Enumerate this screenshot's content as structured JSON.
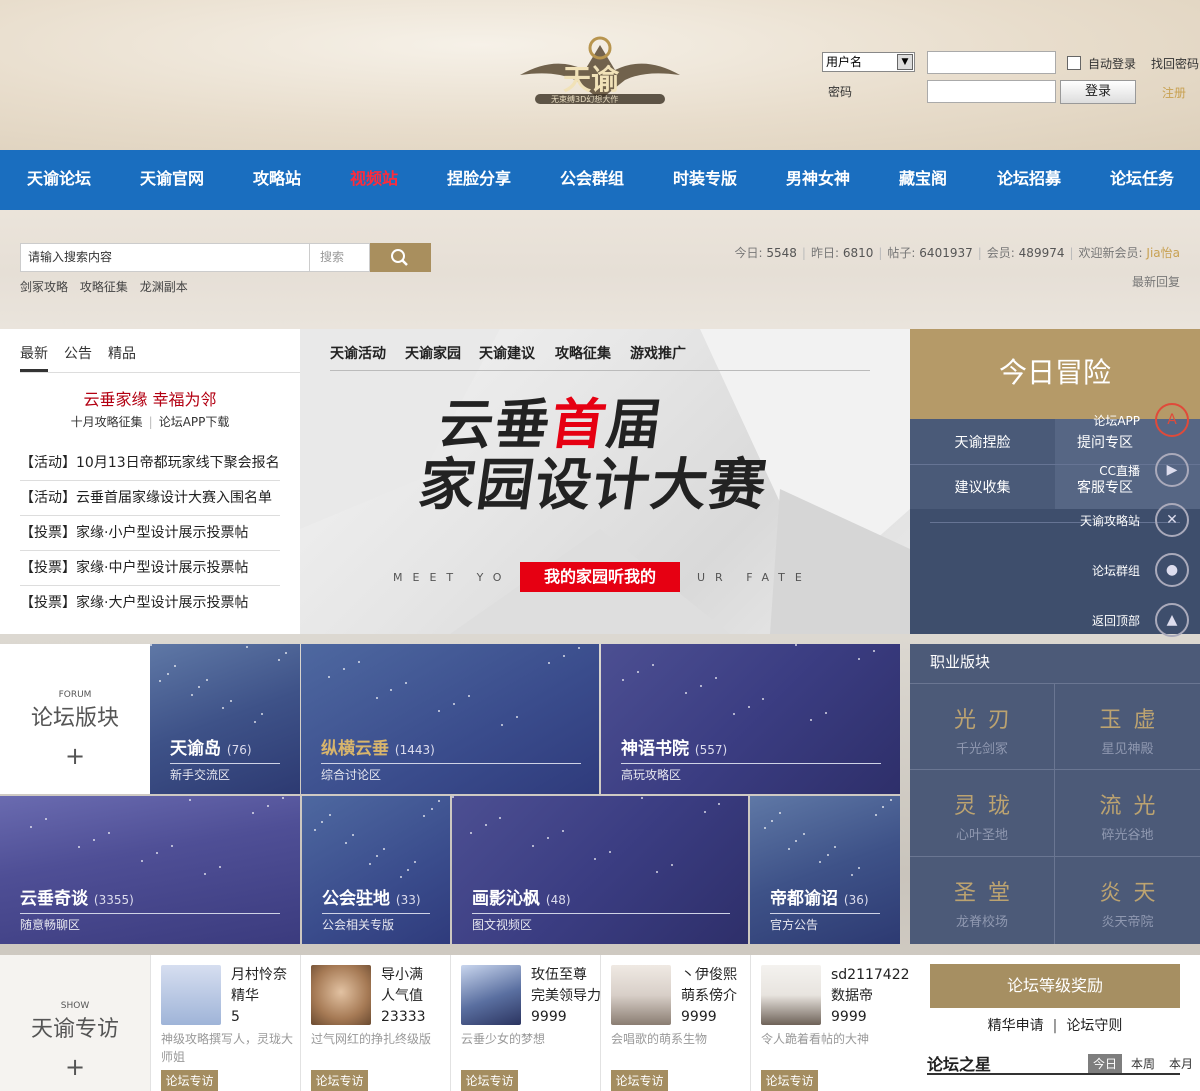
{
  "header": {
    "logo_text": "天谕",
    "logo_sub": "无束缚3D幻想大作",
    "login": {
      "user_select": "用户名",
      "password_label": "密码",
      "auto_login": "自动登录",
      "find_password": "找回密码",
      "login_button": "登录",
      "register": "注册"
    }
  },
  "nav": {
    "items": [
      "天谕论坛",
      "天谕官网",
      "攻略站",
      "视频站",
      "捏脸分享",
      "公会群组",
      "时装专版",
      "男神女神",
      "藏宝阁",
      "论坛招募",
      "论坛任务"
    ],
    "highlight_index": 3
  },
  "search": {
    "placeholder": "请输入搜索内容",
    "type": "搜索",
    "tags": [
      "剑冢攻略",
      "攻略征集",
      "龙渊副本"
    ]
  },
  "stats": {
    "today_label": "今日:",
    "today": "5548",
    "yesterday_label": "昨日:",
    "yesterday": "6810",
    "posts_label": "帖子:",
    "posts": "6401937",
    "members_label": "会员:",
    "members": "489974",
    "welcome_label": "欢迎新会员:",
    "new_member": "Jia怡a",
    "latest_reply": "最新回复"
  },
  "news": {
    "tabs": [
      "最新",
      "公告",
      "精品"
    ],
    "headline": "云垂家缘  幸福为邻",
    "sub_left": "十月攻略征集",
    "sub_right": "论坛APP下载",
    "items": [
      "【活动】10月13日帝都玩家线下聚会报名",
      "【活动】云垂首届家缘设计大赛入围名单",
      "【投票】家缘·小户型设计展示投票帖",
      "【投票】家缘·中户型设计展示投票帖",
      "【投票】家缘·大户型设计展示投票帖"
    ]
  },
  "banner": {
    "tabs": [
      "天谕活动",
      "天谕家园",
      "天谕建议",
      "攻略征集",
      "游戏推广"
    ],
    "title_a": "云垂",
    "title_red": "首",
    "title_b": "届",
    "title_line2": "家园设计大赛",
    "slogan_left": "MEET YO",
    "slogan_right": "UR FATE",
    "slogan": "我的家园听我的"
  },
  "adventure": {
    "title": "今日冒险",
    "cells": [
      "天谕捏脸",
      "提问专区",
      "建议收集",
      "客服专区"
    ],
    "side": [
      "论坛APP",
      "CC直播",
      "天谕攻略站",
      "论坛群组",
      "返回顶部"
    ]
  },
  "forum": {
    "label_en": "FORUM",
    "label_cn": "论坛版块",
    "plus": "+",
    "boards": [
      {
        "name": "天谕岛",
        "count": "(76)",
        "sub": "新手交流区"
      },
      {
        "name": "纵横云垂",
        "count": "(1443)",
        "sub": "综合讨论区"
      },
      {
        "name": "神语书院",
        "count": "(557)",
        "sub": "高玩攻略区"
      },
      {
        "name": "云垂奇谈",
        "count": "(3355)",
        "sub": "随意畅聊区"
      },
      {
        "name": "公会驻地",
        "count": "(33)",
        "sub": "公会相关专版"
      },
      {
        "name": "画影沁枫",
        "count": "(48)",
        "sub": "图文视频区"
      },
      {
        "name": "帝都谕诏",
        "count": "(36)",
        "sub": "官方公告"
      }
    ]
  },
  "jobs": {
    "title": "职业版块",
    "items": [
      {
        "name": "光刃",
        "sub": "千光剑冢"
      },
      {
        "name": "玉虚",
        "sub": "星见神殿"
      },
      {
        "name": "灵珑",
        "sub": "心叶圣地"
      },
      {
        "name": "流光",
        "sub": "碎光谷地"
      },
      {
        "name": "圣堂",
        "sub": "龙脊校场"
      },
      {
        "name": "炎天",
        "sub": "炎天帝院"
      }
    ]
  },
  "show": {
    "label_en": "SHOW",
    "label_cn": "天谕专访",
    "plus": "+",
    "tag": "论坛专访",
    "items": [
      {
        "name": "月村怜奈",
        "l2": "精华",
        "l3": "5",
        "desc": "神级攻略撰写人，灵珑大师姐",
        "color": "#9fb4d8"
      },
      {
        "name": "导小满",
        "l2": "人气值",
        "l3": "23333",
        "desc": "过气网红的挣扎终级版",
        "color": "#c49a78"
      },
      {
        "name": "玫伍至尊",
        "l2": "完美领导力",
        "l3": "9999",
        "desc": "云垂少女的梦想",
        "color": "#5a6fa0"
      },
      {
        "name": "丶伊俊熙",
        "l2": "萌系傍介",
        "l3": "9999",
        "desc": "会唱歌的萌系生物",
        "color": "#d8cfc8"
      },
      {
        "name": "sd2117422",
        "l2": "数据帝",
        "l3": "9999",
        "desc": "令人跪着看帖的大神",
        "color": "#e8e4df"
      }
    ]
  },
  "rank": {
    "button": "论坛等级奖励",
    "link1": "精华申请",
    "sep": "|",
    "link2": "论坛守则",
    "star_title": "论坛之星",
    "tabs": [
      "今日",
      "本周",
      "本月"
    ]
  },
  "colors": {
    "nav_bg": "#1a6ebf",
    "gold": "#a98f5e",
    "highlight_red": "#ff2b3a"
  }
}
